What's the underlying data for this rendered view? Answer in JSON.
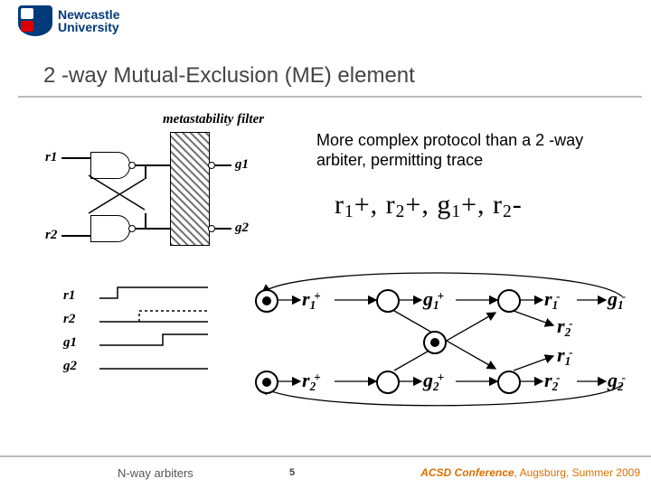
{
  "university": {
    "line1": "Newcastle",
    "line2": "University"
  },
  "title": "2 -way Mutual-Exclusion (ME) element",
  "description": "More complex protocol than a 2 -way arbiter, permitting trace",
  "trace_parts": {
    "r1": "r",
    "p": "+, ",
    "r2": "r",
    "g1": "g",
    "r2m": "r",
    "minus": "-"
  },
  "circuit": {
    "filter_label": "metastability filter",
    "inputs": {
      "r1": "r1",
      "r2": "r2"
    },
    "outputs": {
      "g1": "g1",
      "g2": "g2"
    }
  },
  "timing_labels": [
    "r1",
    "r2",
    "g1",
    "g2"
  ],
  "petri": {
    "labels": [
      "r1+",
      "g1+",
      "r1-",
      "g1-",
      "r2-",
      "r1-",
      "r2+",
      "g2+",
      "r2-",
      "g2-"
    ]
  },
  "footer": {
    "left": "N-way arbiters",
    "page": "5",
    "conf": "ACSD Conference",
    "loc": ", Augsburg, Summer 2009"
  }
}
